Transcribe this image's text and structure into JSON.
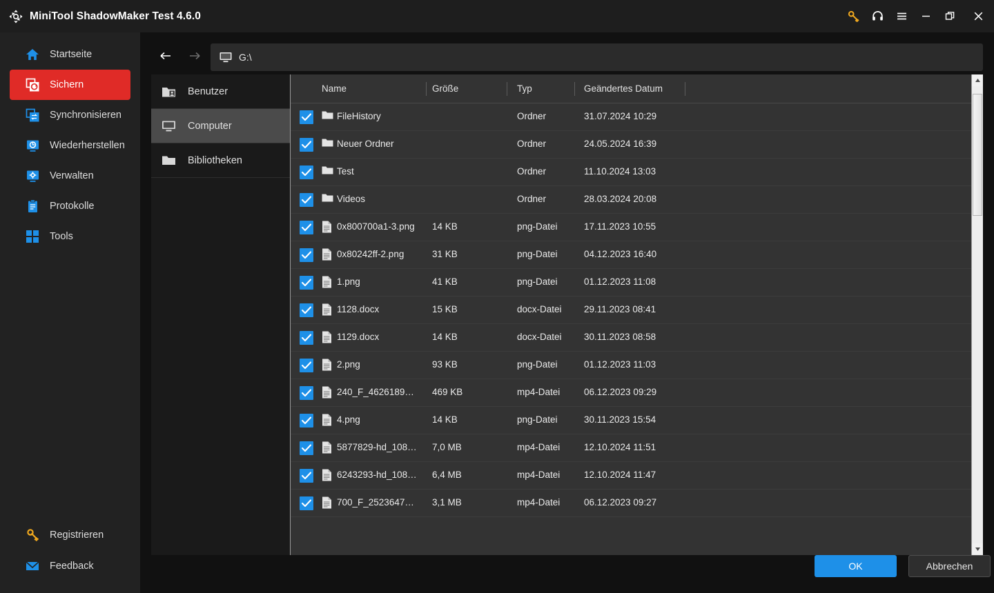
{
  "titlebar": {
    "app_title": "MiniTool ShadowMaker Test 4.6.0",
    "logo_icon": "shadowmaker-logo-icon",
    "actions": [
      {
        "name": "key-icon",
        "label": "",
        "color": "#f0a81e"
      },
      {
        "name": "headset-icon",
        "label": "",
        "color": "#ffffff"
      },
      {
        "name": "menu-icon",
        "label": "",
        "color": "#ffffff"
      },
      {
        "name": "minimize-icon",
        "label": "",
        "color": "#ffffff"
      },
      {
        "name": "restore-icon",
        "label": "",
        "color": "#ffffff"
      },
      {
        "name": "close-icon",
        "label": "",
        "color": "#ffffff"
      }
    ]
  },
  "sidebar": {
    "items": [
      {
        "label": "Startseite",
        "icon": "home-icon",
        "active": false
      },
      {
        "label": "Sichern",
        "icon": "backup-icon",
        "active": true
      },
      {
        "label": "Synchronisieren",
        "icon": "sync-icon",
        "active": false
      },
      {
        "label": "Wiederherstellen",
        "icon": "restore-monitor-icon",
        "active": false
      },
      {
        "label": "Verwalten",
        "icon": "manage-gear-monitor-icon",
        "active": false
      },
      {
        "label": "Protokolle",
        "icon": "logs-clipboard-icon",
        "active": false
      },
      {
        "label": "Tools",
        "icon": "tools-grid-icon",
        "active": false
      }
    ],
    "bottom_items": [
      {
        "label": "Registrieren",
        "icon": "key-icon",
        "color": "#f0a81e"
      },
      {
        "label": "Feedback",
        "icon": "mail-icon",
        "color": "#1e90e8"
      }
    ],
    "accent_active": "#e02b27",
    "accent_icon": "#1e90e8"
  },
  "toolbar": {
    "back_icon": "arrow-left-icon",
    "forward_icon": "arrow-right-icon",
    "path_icon": "monitor-icon",
    "path_value": "G:\\"
  },
  "tree": {
    "items": [
      {
        "label": "Benutzer",
        "icon": "users-folder-icon",
        "selected": false
      },
      {
        "label": "Computer",
        "icon": "monitor-icon",
        "selected": true
      },
      {
        "label": "Bibliotheken",
        "icon": "folder-icon",
        "selected": false
      }
    ]
  },
  "filelist": {
    "columns": [
      "Name",
      "Größe",
      "Typ",
      "Geändertes Datum"
    ],
    "rows": [
      {
        "checked": true,
        "icon": "folder-icon",
        "name": "FileHistory",
        "size": "",
        "type": "Ordner",
        "date": "31.07.2024 10:29"
      },
      {
        "checked": true,
        "icon": "folder-icon",
        "name": "Neuer Ordner",
        "size": "",
        "type": "Ordner",
        "date": "24.05.2024 16:39"
      },
      {
        "checked": true,
        "icon": "folder-icon",
        "name": "Test",
        "size": "",
        "type": "Ordner",
        "date": "11.10.2024 13:03"
      },
      {
        "checked": true,
        "icon": "folder-icon",
        "name": "Videos",
        "size": "",
        "type": "Ordner",
        "date": "28.03.2024 20:08"
      },
      {
        "checked": true,
        "icon": "file-icon",
        "name": "0x800700a1-3.png",
        "size": "14 KB",
        "type": "png-Datei",
        "date": "17.11.2023 10:55"
      },
      {
        "checked": true,
        "icon": "file-icon",
        "name": "0x80242ff-2.png",
        "size": "31 KB",
        "type": "png-Datei",
        "date": "04.12.2023 16:40"
      },
      {
        "checked": true,
        "icon": "file-icon",
        "name": "1.png",
        "size": "41 KB",
        "type": "png-Datei",
        "date": "01.12.2023 11:08"
      },
      {
        "checked": true,
        "icon": "file-icon",
        "name": "1128.docx",
        "size": "15 KB",
        "type": "docx-Datei",
        "date": "29.11.2023 08:41"
      },
      {
        "checked": true,
        "icon": "file-icon",
        "name": "1129.docx",
        "size": "14 KB",
        "type": "docx-Datei",
        "date": "30.11.2023 08:58"
      },
      {
        "checked": true,
        "icon": "file-icon",
        "name": "2.png",
        "size": "93 KB",
        "type": "png-Datei",
        "date": "01.12.2023 11:03"
      },
      {
        "checked": true,
        "icon": "file-icon",
        "name": "240_F_4626189…",
        "size": "469 KB",
        "type": "mp4-Datei",
        "date": "06.12.2023 09:29"
      },
      {
        "checked": true,
        "icon": "file-icon",
        "name": "4.png",
        "size": "14 KB",
        "type": "png-Datei",
        "date": "30.11.2023 15:54"
      },
      {
        "checked": true,
        "icon": "file-icon",
        "name": "5877829-hd_108…",
        "size": "7,0 MB",
        "type": "mp4-Datei",
        "date": "12.10.2024 11:51"
      },
      {
        "checked": true,
        "icon": "file-icon",
        "name": "6243293-hd_108…",
        "size": "6,4 MB",
        "type": "mp4-Datei",
        "date": "12.10.2024 11:47"
      },
      {
        "checked": true,
        "icon": "file-icon",
        "name": "700_F_2523647…",
        "size": "3,1 MB",
        "type": "mp4-Datei",
        "date": "06.12.2023 09:27"
      }
    ]
  },
  "footer": {
    "ok_label": "OK",
    "cancel_label": "Abbrechen",
    "ok_color": "#1e90e8"
  }
}
